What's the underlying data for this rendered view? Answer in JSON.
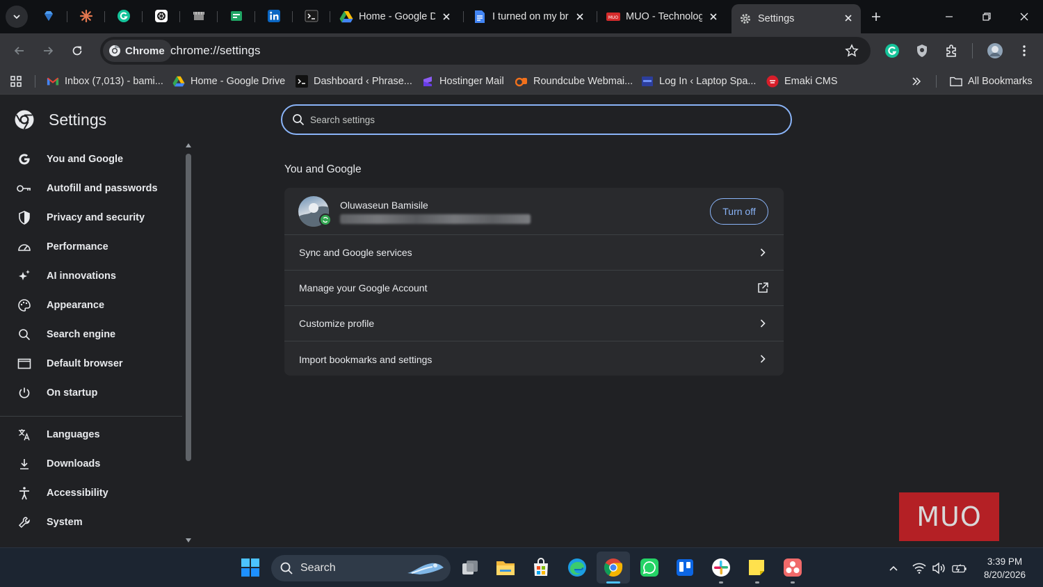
{
  "tabs": [
    {
      "title": "Home - Google Drive",
      "icon": "google-drive-icon"
    },
    {
      "title": "I turned on my browser",
      "icon": "google-docs-icon"
    },
    {
      "title": "MUO - Technology",
      "icon": "muo-icon"
    },
    {
      "title": "Settings",
      "icon": "gear-icon",
      "active": true
    }
  ],
  "omnibox": {
    "chip_label": "Chrome",
    "url": "chrome://settings"
  },
  "bookmarks": [
    {
      "label": "Inbox (7,013) - bami...",
      "icon": "gmail-icon"
    },
    {
      "label": "Home - Google Drive",
      "icon": "google-drive-icon"
    },
    {
      "label": "Dashboard ‹ Phrase...",
      "icon": "wordpress-icon"
    },
    {
      "label": "Hostinger Mail",
      "icon": "hostinger-icon"
    },
    {
      "label": "Roundcube Webmai...",
      "icon": "roundcube-icon"
    },
    {
      "label": "Log In ‹ Laptop Spa...",
      "icon": "laptop-icon"
    },
    {
      "label": "Emaki CMS",
      "icon": "emaki-icon"
    }
  ],
  "all_bookmarks_label": "All Bookmarks",
  "settings": {
    "title": "Settings",
    "search_placeholder": "Search settings",
    "nav": [
      {
        "label": "You and Google",
        "icon": "google-g-icon"
      },
      {
        "label": "Autofill and passwords",
        "icon": "key-icon"
      },
      {
        "label": "Privacy and security",
        "icon": "shield-icon"
      },
      {
        "label": "Performance",
        "icon": "speedometer-icon"
      },
      {
        "label": "AI innovations",
        "icon": "sparkle-icon"
      },
      {
        "label": "Appearance",
        "icon": "palette-icon"
      },
      {
        "label": "Search engine",
        "icon": "search-icon"
      },
      {
        "label": "Default browser",
        "icon": "browser-window-icon"
      },
      {
        "label": "On startup",
        "icon": "power-icon"
      },
      {
        "label": "Languages",
        "icon": "translate-icon"
      },
      {
        "label": "Downloads",
        "icon": "download-icon"
      },
      {
        "label": "Accessibility",
        "icon": "accessibility-icon"
      },
      {
        "label": "System",
        "icon": "wrench-icon"
      }
    ],
    "section_title": "You and Google",
    "profile": {
      "name": "Oluwaseun Bamisile",
      "turn_off_label": "Turn off"
    },
    "rows": [
      {
        "label": "Sync and Google services",
        "icon": "chevron-right-icon"
      },
      {
        "label": "Manage your Google Account",
        "icon": "external-link-icon"
      },
      {
        "label": "Customize profile",
        "icon": "chevron-right-icon"
      },
      {
        "label": "Import bookmarks and settings",
        "icon": "chevron-right-icon"
      }
    ]
  },
  "watermark": "MUO",
  "taskbar": {
    "search_label": "Search",
    "time": "3:39 PM",
    "date": "8/20/2026"
  },
  "colors": {
    "accent": "#8ab4f8",
    "page_bg": "#202124",
    "card_bg": "#292a2d",
    "toolbar_bg": "#35363a",
    "muo_red": "#b42025"
  }
}
